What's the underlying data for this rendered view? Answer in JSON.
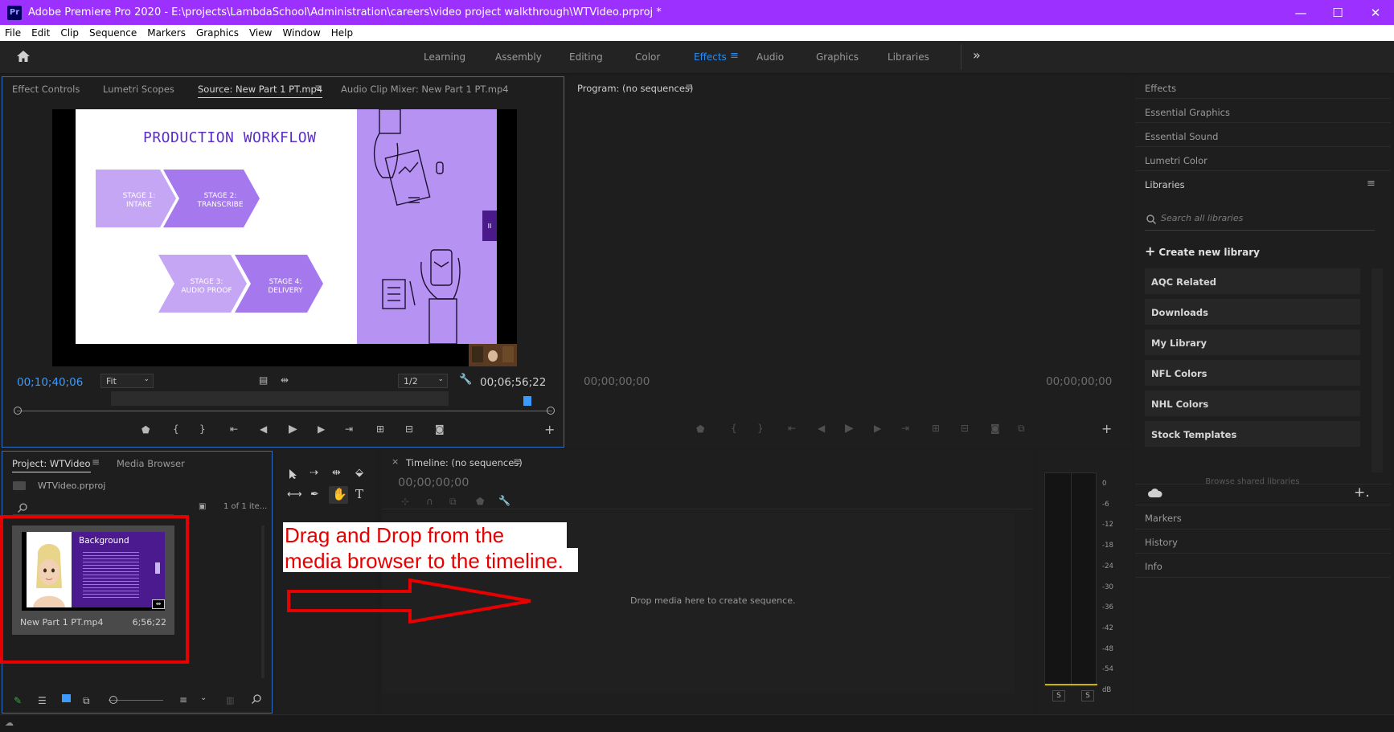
{
  "titlebar": {
    "app_icon": "Pr",
    "title": "Adobe Premiere Pro 2020 - E:\\projects\\LambdaSchool\\Administration\\careers\\video project walkthrough\\WTVideo.prproj *",
    "minimize": "—",
    "maximize": "☐",
    "close": "✕"
  },
  "menu": [
    "File",
    "Edit",
    "Clip",
    "Sequence",
    "Markers",
    "Graphics",
    "View",
    "Window",
    "Help"
  ],
  "workspaces": [
    "Learning",
    "Assembly",
    "Editing",
    "Color",
    "Effects",
    "Audio",
    "Graphics",
    "Libraries"
  ],
  "workspace_overflow": "»",
  "source_panel": {
    "tabs": [
      "Effect Controls",
      "Lumetri Scopes",
      "Source: New Part 1 PT.mp4",
      "Audio Clip Mixer: New Part 1 PT.mp4"
    ],
    "timecode_current": "00;10;40;06",
    "zoom": "Fit",
    "resolution": "1/2",
    "timecode_duration": "00;06;56;22",
    "slide": {
      "title": "PRODUCTION WORKFLOW",
      "stage1": "STAGE 1:\nINTAKE",
      "stage2": "STAGE 2:\nTRANSCRIBE",
      "stage3": "STAGE 3:\nAUDIO PROOF",
      "stage4": "STAGE 4:\nDELIVERY",
      "side_tab": "II"
    }
  },
  "program_panel": {
    "title": "Program: (no sequences)",
    "timecode_left": "00;00;00;00",
    "timecode_right": "00;00;00;00"
  },
  "right_panel": {
    "effects": "Effects",
    "essential_graphics": "Essential Graphics",
    "essential_sound": "Essential Sound",
    "lumetri_color": "Lumetri Color",
    "libraries": "Libraries",
    "search_placeholder": "Search all libraries",
    "create_library": "Create new library",
    "library_items": [
      "AQC Related",
      "Downloads",
      "My Library",
      "NFL Colors",
      "NHL Colors",
      "Stock Templates"
    ],
    "browse_shared": "Browse shared libraries",
    "markers": "Markers",
    "history": "History",
    "info": "Info"
  },
  "project_panel": {
    "tabs": [
      "Project: WTVideo",
      "Media Browser"
    ],
    "project_file": "WTVideo.prproj",
    "item_count": "1 of 1 ite...",
    "clip": {
      "name": "New Part 1 PT.mp4",
      "duration": "6;56;22",
      "thumb_title": "Background"
    }
  },
  "timeline_panel": {
    "title": "Timeline: (no sequences)",
    "timecode": "00;00;00;00",
    "drop_hint": "Drop media here to create sequence."
  },
  "audio_meter": {
    "scale": [
      "0",
      "-6",
      "-12",
      "-18",
      "-24",
      "-30",
      "-36",
      "-42",
      "-48",
      "-54",
      "dB"
    ],
    "solo": [
      "S",
      "S"
    ]
  },
  "annotation": {
    "line1": "Drag and Drop from the",
    "line2": "media browser to the timeline."
  },
  "colors": {
    "accent": "#2d8ceb",
    "titlebar": "#9b30ff",
    "annotation": "#e60000",
    "slide_purple": "#b693f3"
  }
}
